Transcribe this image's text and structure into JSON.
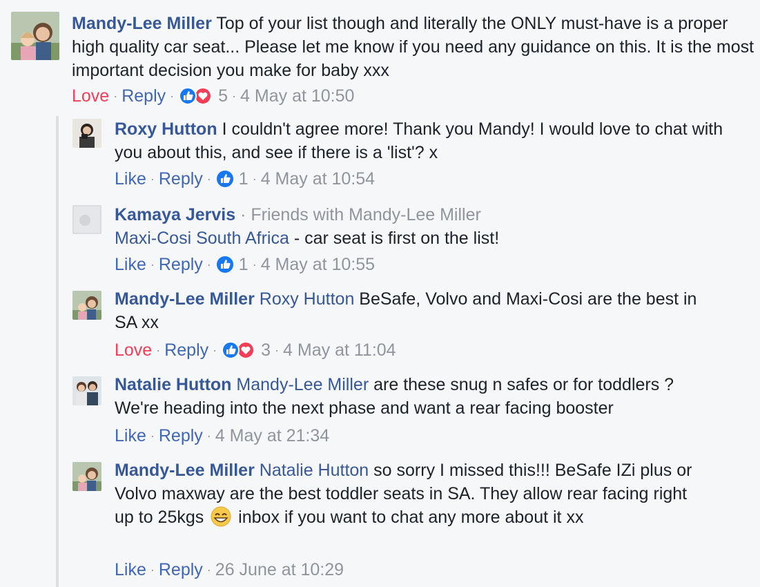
{
  "comments": [
    {
      "author": "Mandy-Lee Miller",
      "text": "Top of your list though and literally the ONLY must-have is a proper high quality car seat... Please let me know if you need any guidance on this. It is the most important decision you make for baby xxx",
      "reaction_label": "Love",
      "reply_label": "Reply",
      "reactions": [
        "like",
        "love"
      ],
      "count": "5",
      "time": "4 May at 10:50"
    },
    {
      "author": "Roxy Hutton",
      "text": "I couldn't agree more! Thank you Mandy! I would love to chat with you about this, and see if there is a 'list'? x",
      "reaction_label": "Like",
      "reply_label": "Reply",
      "reactions": [
        "like"
      ],
      "count": "1",
      "time": "4 May at 10:54"
    },
    {
      "author": "Kamaya Jervis",
      "friends_note": "Friends with Mandy-Lee Miller",
      "mention": "Maxi-Cosi South Africa",
      "text": "- car seat is first on the list!",
      "reaction_label": "Like",
      "reply_label": "Reply",
      "reactions": [
        "like"
      ],
      "count": "1",
      "time": "4 May at 10:55"
    },
    {
      "author": "Mandy-Lee Miller",
      "mention": "Roxy Hutton",
      "text": "BeSafe, Volvo and Maxi-Cosi are the best in SA xx",
      "reaction_label": "Love",
      "reply_label": "Reply",
      "reactions": [
        "like",
        "love"
      ],
      "count": "3",
      "time": "4 May at 11:04"
    },
    {
      "author": "Natalie Hutton",
      "mention": "Mandy-Lee Miller",
      "text": "are these snug n safes or for toddlers ? We're heading into the next phase and want a rear facing booster",
      "reaction_label": "Like",
      "reply_label": "Reply",
      "time": "4 May at 21:34"
    },
    {
      "author": "Mandy-Lee Miller",
      "mention": "Natalie Hutton",
      "text_before_emoji": "so sorry I missed this!!! BeSafe IZi plus or Volvo maxway are the best toddler seats in SA. They allow rear facing right up to 25kgs",
      "emoji": "grinning-emoji",
      "text_after_emoji": "inbox if you want to chat any more about it xx",
      "reaction_label": "Like",
      "reply_label": "Reply",
      "time": "26 June at 10:29"
    }
  ],
  "colors": {
    "name": "#365899",
    "link": "#4267b2",
    "love": "#f33e58",
    "meta": "#90949c",
    "background": "#f6f7f9"
  }
}
